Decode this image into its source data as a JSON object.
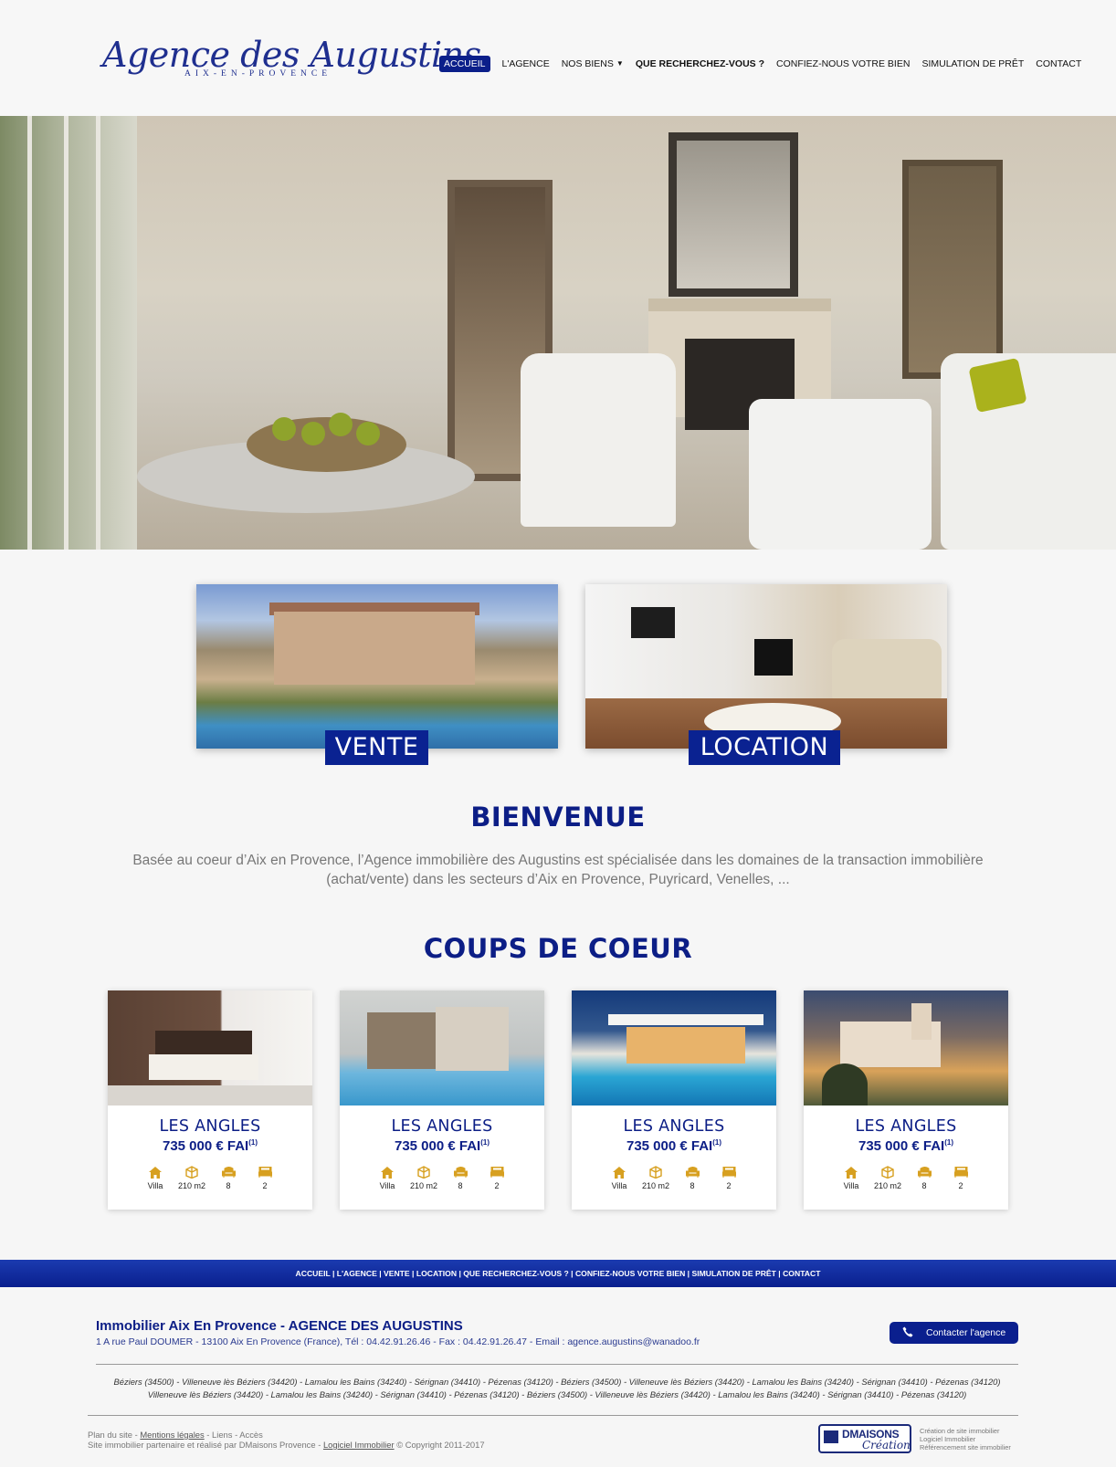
{
  "brand": {
    "logo_script": "Agence des Augustins",
    "logo_sub": "AIX-EN-PROVENCE"
  },
  "nav": {
    "items": [
      {
        "label": "ACCUEIL"
      },
      {
        "label": "L'AGENCE"
      },
      {
        "label": "NOS BIENS"
      },
      {
        "label": "QUE RECHERCHEZ-VOUS ?"
      },
      {
        "label": "CONFIEZ-NOUS VOTRE BIEN"
      },
      {
        "label": "SIMULATION DE PRÊT"
      },
      {
        "label": "CONTACT"
      }
    ],
    "active_color": "#0b1f8a"
  },
  "categories": {
    "vente": "VENTE",
    "location": "LOCATION"
  },
  "welcome": {
    "title": "BIENVENUE",
    "text": "Basée au coeur d’Aix en Provence, l’Agence immobilière des Augustins est spécialisée dans les domaines de la transaction immobilière (achat/vente) dans les secteurs d’Aix en Provence, Puyricard, Venelles, ..."
  },
  "coups_de_coeur": {
    "title": "COUPS DE COEUR",
    "cards": [
      {
        "city": "LES ANGLES",
        "price": "735 000 € FAI",
        "note": "(1)",
        "type": "Villa",
        "surface": "210 m2",
        "rooms": "8",
        "beds": "2"
      },
      {
        "city": "LES ANGLES",
        "price": "735 000 € FAI",
        "note": "(1)",
        "type": "Villa",
        "surface": "210 m2",
        "rooms": "8",
        "beds": "2"
      },
      {
        "city": "LES ANGLES",
        "price": "735 000 € FAI",
        "note": "(1)",
        "type": "Villa",
        "surface": "210 m2",
        "rooms": "8",
        "beds": "2"
      },
      {
        "city": "LES ANGLES",
        "price": "735 000 € FAI",
        "note": "(1)",
        "type": "Villa",
        "surface": "210 m2",
        "rooms": "8",
        "beds": "2"
      }
    ],
    "icon_color": "#d7a020"
  },
  "footer": {
    "nav_line": "ACCUEIL | L'AGENCE | VENTE | LOCATION | QUE RECHERCHEZ-VOUS ? | CONFIEZ-NOUS VOTRE BIEN | SIMULATION DE PRÊT | CONTACT",
    "title": "Immobilier Aix En Provence - AGENCE DES AUGUSTINS",
    "address": "1 A rue Paul DOUMER - 13100 Aix En Provence (France), Tél : 04.42.91.26.46 - Fax : 04.42.91.26.47 - Email : agence.augustins@wanadoo.fr",
    "contact_button": "Contacter l'agence",
    "cities_line1": "Béziers (34500) - Villeneuve lès Béziers (34420) - Lamalou les Bains (34240) - Sérignan (34410) - Pézenas (34120) - Béziers (34500) - Villeneuve lès Béziers (34420) - Lamalou les Bains (34240) - Sérignan (34410) - Pézenas (34120)",
    "cities_line2": "Villeneuve lès Béziers (34420) - Lamalou les Bains (34240) - Sérignan (34410) - Pézenas (34120) - Béziers (34500) - Villeneuve lès Béziers (34420) - Lamalou les Bains (34240) - Sérignan (34410) - Pézenas (34120)",
    "legal": {
      "plan": "Plan du site",
      "mentions": "Mentions légales",
      "liens": "Liens",
      "acces": "Accès",
      "partner_prefix": "Site immobilier partenaire et réalisé par DMaisons Provence",
      "logiciel": "Logiciel Immobilier",
      "copyright": "© Copyright 2011-2017"
    },
    "dm": {
      "name": "DMAISONS",
      "script": "Création",
      "side1": "Création de site immobilier",
      "side2": "Logiciel Immobilier",
      "side3": "Référencement site immobilier"
    },
    "bar_color": "#0a1f8e"
  }
}
